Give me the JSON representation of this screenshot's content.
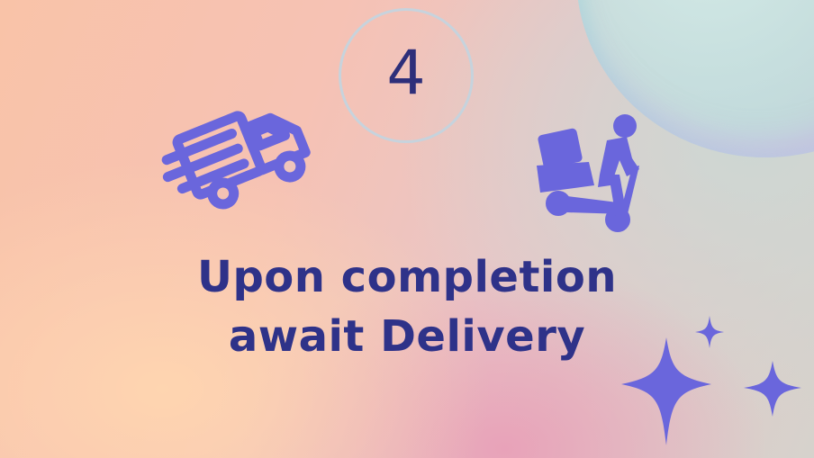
{
  "slide": {
    "step_number": "4",
    "headline_line1": "Upon completion",
    "headline_line2": "await Delivery"
  },
  "icons": {
    "truck": "delivery-truck-icon",
    "scooter": "scooter-courier-icon",
    "sparkles": "sparkles-icon"
  },
  "colors": {
    "text": "#2e3289",
    "icon": "#6a66dc",
    "circle_border": "#c4d4de"
  }
}
